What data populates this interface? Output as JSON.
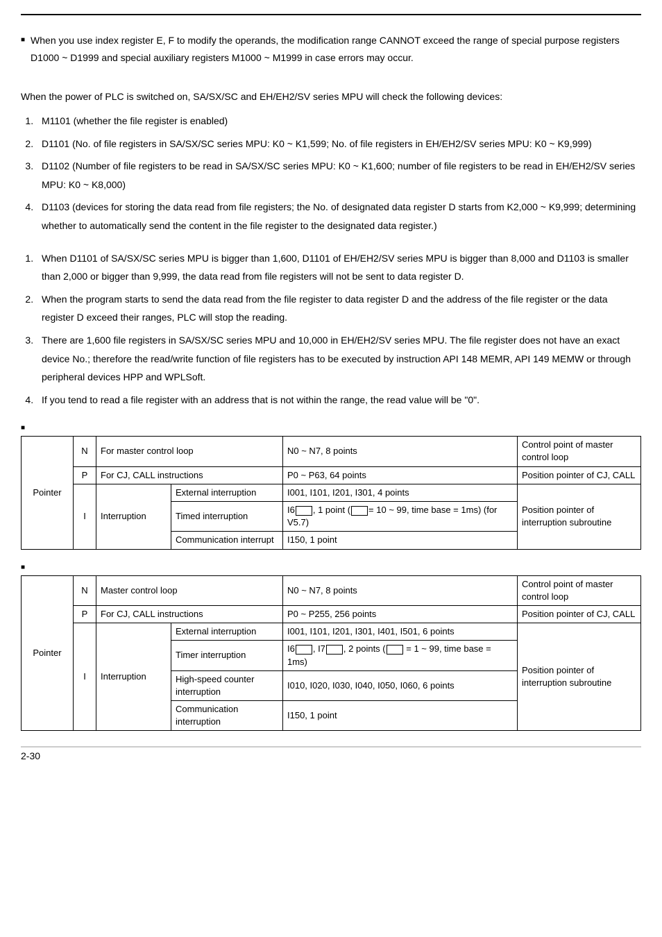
{
  "intro_bullet": "When you use index register E, F to modify the operands, the modification range CANNOT exceed the range of special purpose registers D1000 ~ D1999 and special auxiliary registers M1000 ~ M1999 in case errors may occur.",
  "check_intro": "When the power of PLC is switched on, SA/SX/SC and EH/EH2/SV series MPU will check the following devices:",
  "check_list": {
    "i1": "M1101 (whether the file register is enabled)",
    "i2": "D1101 (No. of file registers in SA/SX/SC series MPU: K0 ~ K1,599; No. of file registers in EH/EH2/SV series MPU: K0 ~ K9,999)",
    "i3": "D1102 (Number of file registers to be read in SA/SX/SC series MPU: K0 ~ K1,600; number of file registers to be read in EH/EH2/SV series MPU: K0 ~ K8,000)",
    "i4": "D1103 (devices for storing the data read from file registers; the No. of designated data register D starts from K2,000 ~ K9,999; determining whether to automatically send the content in the file register to the designated data register.)"
  },
  "notes_list": {
    "n1": "When D1101 of SA/SX/SC series MPU is bigger than 1,600, D1101 of EH/EH2/SV series MPU is bigger than 8,000 and D1103 is smaller than 2,000 or bigger than 9,999, the data read from file registers will not be sent to data register D.",
    "n2": "When the program starts to send the data read from the file register to data register D and the address of the file register or the data register D exceed their ranges, PLC will stop the reading.",
    "n3": "There are 1,600 file registers in SA/SX/SC series MPU and 10,000 in EH/EH2/SV series MPU. The file register does not have an exact device No.; therefore the read/write function of file registers has to be executed by instruction API 148 MEMR, API 149 MEMW or through peripheral devices HPP and WPLSoft.",
    "n4": "If you tend to read a file register with an address that is not within the range, the read value will be \"0\"."
  },
  "table1": {
    "group": "Pointer",
    "rows": {
      "r1": {
        "sym": "N",
        "desc": "For master control loop",
        "range": "N0 ~ N7, 8 points",
        "func": "Control point of master control loop"
      },
      "r2": {
        "sym": "P",
        "desc": "For CJ, CALL instructions",
        "range": "P0 ~ P63, 64 points",
        "func": "Position pointer of CJ, CALL"
      },
      "r3": {
        "sym": "I",
        "sub": "Interruption",
        "t1": "External interruption",
        "v1": "I001, I101, I201, I301, 4 points",
        "t2": "Timed interruption",
        "v2_pre": "I6",
        "v2_mid": ", 1 point (",
        "v2_post": "= 10 ~ 99, time base = 1ms) (for V5.7)",
        "t3": "Communication interrupt",
        "v3": "I150, 1 point",
        "func": "Position pointer of interruption subroutine"
      }
    }
  },
  "table2": {
    "group": "Pointer",
    "rows": {
      "r1": {
        "sym": "N",
        "desc": "Master control loop",
        "range": "N0 ~ N7, 8 points",
        "func": "Control point of master control loop"
      },
      "r2": {
        "sym": "P",
        "desc": "For CJ, CALL instructions",
        "range": "P0 ~ P255, 256 points",
        "func": "Position pointer of CJ, CALL"
      },
      "r3": {
        "sym": "I",
        "sub": "Interruption",
        "t1": "External interruption",
        "v1": "I001, I101, I201, I301, I401, I501, 6 points",
        "t2": "Timer interruption",
        "v2_a": "I6",
        "v2_b": ", I7",
        "v2_c": ", 2 points (",
        "v2_d": " = 1 ~ 99, time base = 1ms)",
        "t3": "High-speed counter interruption",
        "v3": "I010, I020, I030, I040, I050, I060, 6 points",
        "t4": "Communication interruption",
        "v4": "I150, 1 point",
        "func": "Position pointer of interruption subroutine"
      }
    }
  },
  "page_num": "2-30"
}
